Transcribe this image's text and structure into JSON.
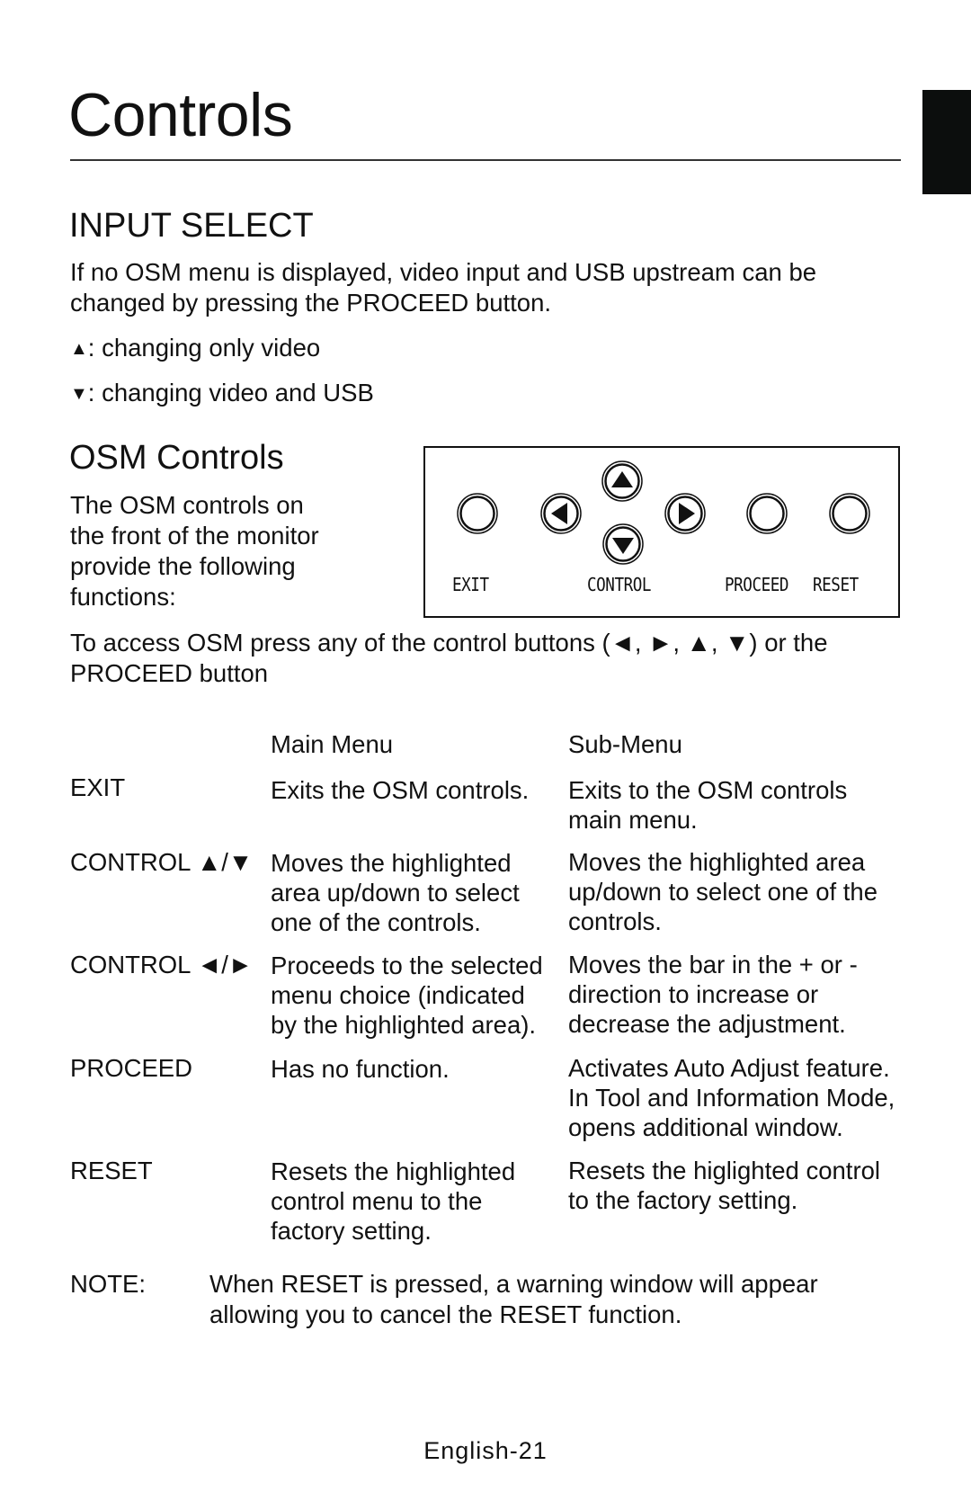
{
  "page": {
    "title": "Controls",
    "footer": "English-21"
  },
  "input_select": {
    "heading": "INPUT SELECT",
    "paragraph_lines": [
      "If no OSM menu is displayed, video input and USB upstream can be",
      "changed by pressing the PROCEED button."
    ],
    "options": [
      {
        "symbol": "▲",
        "text": ": changing only video"
      },
      {
        "symbol": "▼",
        "text": ": changing video and USB"
      }
    ]
  },
  "osm_controls": {
    "heading": "OSM Controls",
    "intro_lines": [
      "The OSM controls on",
      "the front of the monitor",
      "provide the following",
      "functions:"
    ],
    "access_lines": [
      "To access OSM press any of the control buttons (◄, ►, ▲, ▼) or the",
      "PROCEED button"
    ],
    "panel": {
      "buttons": [
        {
          "name": "exit",
          "icon": "circle"
        },
        {
          "name": "left",
          "icon": "arrow-left"
        },
        {
          "name": "up",
          "icon": "arrow-up"
        },
        {
          "name": "down",
          "icon": "arrow-down"
        },
        {
          "name": "right",
          "icon": "arrow-right"
        },
        {
          "name": "proceed",
          "icon": "circle"
        },
        {
          "name": "reset",
          "icon": "circle"
        }
      ],
      "labels": {
        "exit": "EXIT",
        "control": "CONTROL",
        "proceed": "PROCEED",
        "reset": "RESET"
      }
    }
  },
  "table": {
    "headers": {
      "main": "Main Menu",
      "sub": "Sub-Menu"
    },
    "rows": [
      {
        "label": "EXIT",
        "main": [
          "Exits the OSM controls."
        ],
        "sub": [
          "Exits to the OSM controls",
          "main menu."
        ]
      },
      {
        "label": "CONTROL ▲/▼",
        "main": [
          "Moves the highlighted",
          "area up/down to select",
          "one of the controls."
        ],
        "sub": [
          "Moves the highlighted area",
          "up/down to select one of the",
          "controls."
        ]
      },
      {
        "label": "CONTROL ◄/►",
        "main": [
          "Proceeds to the selected",
          "menu choice (indicated",
          "by the highlighted area)."
        ],
        "sub": [
          "Moves the bar in the + or -",
          "direction to increase or",
          "decrease the adjustment."
        ]
      },
      {
        "label": "PROCEED",
        "main": [
          "Has no function."
        ],
        "sub": [
          "Activates Auto Adjust feature.",
          "In Tool and Information Mode,",
          "opens additional window."
        ]
      },
      {
        "label": "RESET",
        "main": [
          "Resets the highlighted",
          "control menu to the",
          "factory setting."
        ],
        "sub": [
          "Resets the higlighted control",
          "to the factory setting."
        ]
      }
    ]
  },
  "note": {
    "label": "NOTE:",
    "lines": [
      "When RESET is pressed, a warning window will appear",
      "allowing you to cancel the RESET function."
    ]
  }
}
